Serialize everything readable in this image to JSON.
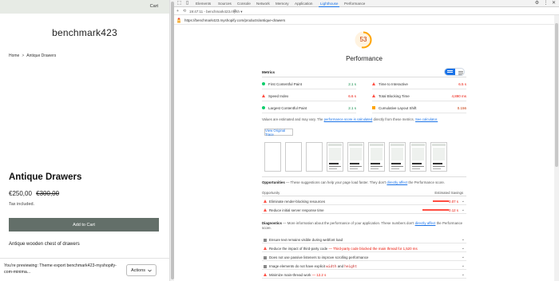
{
  "shop": {
    "cart_label": "Cart",
    "store_name": "benchmark423",
    "breadcrumb": {
      "home": "Home",
      "separator": ">",
      "current": "Antique Drawers"
    },
    "product_title": "Antique Drawers",
    "price": "€250,00",
    "compare_price": "€300,00",
    "tax_note": "Tax included.",
    "add_to_cart_label": "Add to Cart",
    "description": "Antique wooden chest of drawers",
    "preview_text": "You're previewing: Theme export benchmark423-myshopify-com-minima...",
    "actions_label": "Actions",
    "actions_icon": "chevron-down-icon",
    "accent_color": "#636f69"
  },
  "devtools": {
    "tabs": [
      "Elements",
      "Sources",
      "Console",
      "Network",
      "Memory",
      "Application",
      "Lighthouse",
      "Performance"
    ],
    "active_tab": "Lighthouse",
    "report_selector": "19:47:11 - benchmark423.mysh ▾",
    "report_url": "https://benchmark423.myshopify.com/products/antique-drawers"
  },
  "lighthouse": {
    "score": "53",
    "score_fraction": 0.53,
    "category_title": "Performance",
    "metrics_label": "Metrics",
    "metrics": [
      {
        "name": "First Contentful Paint",
        "value": "2.1 s",
        "status": "pass"
      },
      {
        "name": "Time to Interactive",
        "value": "6.5 s",
        "status": "fail"
      },
      {
        "name": "Speed Index",
        "value": "6.6 s",
        "status": "fail"
      },
      {
        "name": "Total Blocking Time",
        "value": "4,890 ms",
        "status": "fail"
      },
      {
        "name": "Largest Contentful Paint",
        "value": "2.1 s",
        "status": "pass"
      },
      {
        "name": "Cumulative Layout Shift",
        "value": "0.156",
        "status": "average"
      }
    ],
    "values_note": {
      "prefix": "Values are estimated and may vary. The ",
      "link1": "performance score is calculated",
      "middle": " directly from these metrics. ",
      "link2": "See calculator."
    },
    "view_trace_label": "View Original Trace",
    "opportunities": {
      "title": "Opportunities",
      "desc_prefix": " — These suggestions can help your page load faster. They don't ",
      "desc_link": "directly affect",
      "desc_suffix": " the Performance score.",
      "col_left": "Opportunity",
      "col_right": "Estimated Savings",
      "items": [
        {
          "label": "Eliminate render-blocking resources",
          "value": "0.07 s",
          "fill": 0.45
        },
        {
          "label": "Reduce initial server response time",
          "value": "0.12 s",
          "fill": 0.75
        }
      ]
    },
    "diagnostics": {
      "title": "Diagnostics",
      "desc_prefix": " — More information about the performance of your application. These numbers don't ",
      "desc_link": "directly affect",
      "desc_suffix": " the Performance score.",
      "items": [
        {
          "type": "info",
          "label": "Ensure text remains visible during webfont load"
        },
        {
          "type": "fail",
          "label": "Reduce the impact of third-party code",
          "highlight": " — Third-party code blocked the main thread for 1,520 ms"
        },
        {
          "type": "info",
          "label": "Does not use passive listeners to improve scrolling performance"
        },
        {
          "type": "info",
          "label": "Image elements do not have explicit ",
          "code1": "width",
          "mid": " and ",
          "code2": "height"
        },
        {
          "type": "fail",
          "label": "Minimize main-thread work",
          "highlight": " — 12.2 s"
        }
      ]
    }
  }
}
